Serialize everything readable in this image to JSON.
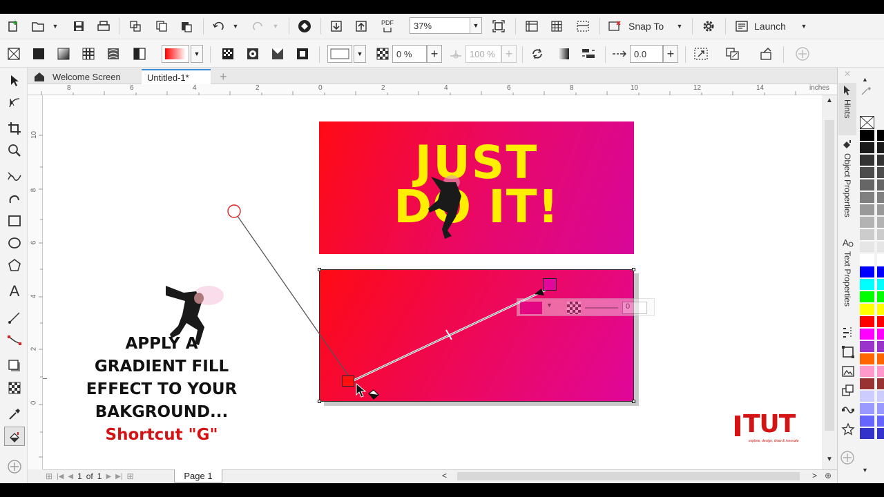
{
  "toolbar1": {
    "zoom_value": "37%",
    "snap_label": "Snap To",
    "launch_label": "Launch",
    "pdf_label": "PDF"
  },
  "toolbar2": {
    "transparency_value": "0 %",
    "opacity_value": "100 %",
    "offset_value": "0.0"
  },
  "tabs": [
    {
      "label": "Welcome Screen"
    },
    {
      "label": "Untitled-1*"
    }
  ],
  "ruler": {
    "unit": "inches",
    "h_ticks": [
      "8",
      "6",
      "4",
      "2",
      "0",
      "2",
      "4",
      "6",
      "8",
      "10",
      "12",
      "14"
    ],
    "v_ticks": [
      "10",
      "8",
      "6",
      "4",
      "2",
      "0"
    ]
  },
  "banner": {
    "line1": "JUST",
    "line2": "DO IT!"
  },
  "overlay": {
    "line1": "APPLY A",
    "line2": "GRADIENT FILL",
    "line3": "EFFECT TO YOUR",
    "line4": "BAKGROUND...",
    "shortcut": "Shortcut \"G\""
  },
  "logo": {
    "text": "TUT",
    "tagline": "explore, design, draw & innovate"
  },
  "floating_toolbar": {
    "value": "0"
  },
  "page_nav": {
    "current": "1",
    "of_label": "of",
    "total": "1",
    "page_tab": "Page 1"
  },
  "dockers": {
    "hints": "Hints",
    "object_properties": "Object Properties",
    "text_properties": "Text Properties"
  },
  "palette": [
    "#000000",
    "#1a1a1a",
    "#333333",
    "#4d4d4d",
    "#666666",
    "#808080",
    "#999999",
    "#b3b3b3",
    "#cccccc",
    "#e6e6e6",
    "#ffffff",
    "#0000ff",
    "#00ffff",
    "#00ff00",
    "#ffff00",
    "#ff0000",
    "#ff00ff",
    "#9933cc",
    "#ff6600",
    "#ff99cc",
    "#993333",
    "#ccccff",
    "#9999ff",
    "#6666ff",
    "#3333cc"
  ],
  "colors": {
    "gradient_start": "#ff0a14",
    "gradient_end": "#e0079a",
    "banner_text": "#ffee00",
    "accent_red": "#d41414"
  }
}
